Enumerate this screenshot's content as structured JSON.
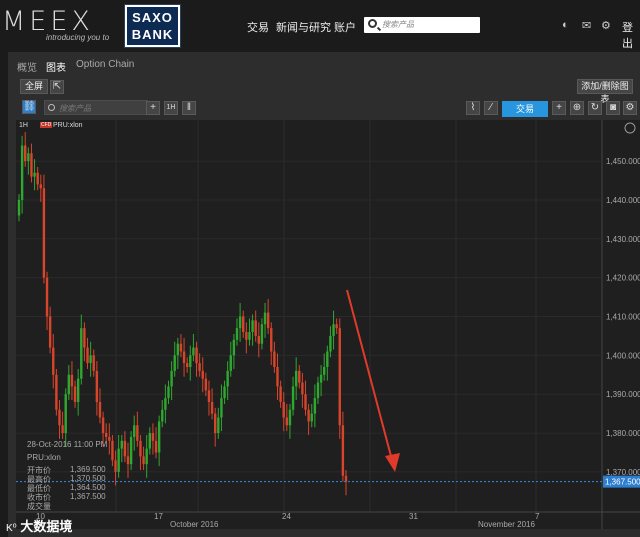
{
  "brand": {
    "left_logo": "MEEX",
    "tagline": "introducing you to",
    "bank_line1": "SAXO",
    "bank_line2": "BANK"
  },
  "nav": {
    "trade": "交易",
    "news": "新闻与研究",
    "account": "账户",
    "search_placeholder": "搜索产品",
    "login": "登出"
  },
  "tabs": [
    {
      "label": "概览"
    },
    {
      "label": "图表"
    },
    {
      "label": "Option Chain"
    }
  ],
  "toolbar": {
    "fullscreen": "全屏",
    "add_delete": "添加/删除图表",
    "instrument_placeholder": "搜索产品",
    "trade_button": "交易",
    "timeframe": "1H"
  },
  "instrument": {
    "name": "PRU:xlon",
    "badge": "CFD"
  },
  "tooltip": {
    "datetime": "28-Oct-2016 11:00 PM",
    "name": "PRU:xlon",
    "rows": [
      {
        "label": "开市价",
        "value": "1,369.500"
      },
      {
        "label": "最高价",
        "value": "1,370.500"
      },
      {
        "label": "最低价",
        "value": "1,364.500"
      },
      {
        "label": "收市价",
        "value": "1,367.500"
      },
      {
        "label": "成交量",
        "value": ""
      }
    ]
  },
  "watermark": "大数据境",
  "chart_data": {
    "type": "candlestick",
    "symbol": "PRU:xlon",
    "interval": "1H",
    "ylim": [
      1362,
      1458
    ],
    "y_ticks": [
      "1,370.000",
      "1,380.000",
      "1,390.000",
      "1,400.000",
      "1,410.000",
      "1,420.000",
      "1,430.000",
      "1,440.000",
      "1,450.000"
    ],
    "x_ticks": [
      "10",
      "17",
      "24",
      "31",
      "7"
    ],
    "x_month_labels": [
      "October 2016",
      "November 2016"
    ],
    "last_price": "1,367.500",
    "up_color": "#2fa82f",
    "down_color": "#d9452b",
    "closes": [
      1440,
      1454,
      1450,
      1452,
      1446,
      1447,
      1444,
      1443,
      1420,
      1410,
      1402,
      1395,
      1386,
      1382,
      1380,
      1390,
      1395,
      1392,
      1388,
      1394,
      1407,
      1402,
      1398,
      1400,
      1396,
      1388,
      1384,
      1380,
      1379,
      1378,
      1373,
      1370,
      1376,
      1378,
      1374,
      1372,
      1379,
      1382,
      1378,
      1374,
      1372,
      1376,
      1380,
      1378,
      1375,
      1383,
      1386,
      1389,
      1392,
      1396,
      1400,
      1403,
      1401,
      1398,
      1397,
      1400,
      1402,
      1398,
      1396,
      1394,
      1391,
      1388,
      1385,
      1380,
      1384,
      1389,
      1392,
      1396,
      1400,
      1404,
      1407,
      1410,
      1406,
      1404,
      1406,
      1409,
      1405,
      1403,
      1408,
      1411,
      1407,
      1401,
      1397,
      1392,
      1388,
      1384,
      1382,
      1386,
      1392,
      1396,
      1393,
      1390,
      1386,
      1383,
      1385,
      1389,
      1393,
      1395,
      1397,
      1401,
      1405,
      1408,
      1407,
      1382,
      1369,
      1367.5
    ],
    "annotation": "red arrow pointing down to last price"
  }
}
